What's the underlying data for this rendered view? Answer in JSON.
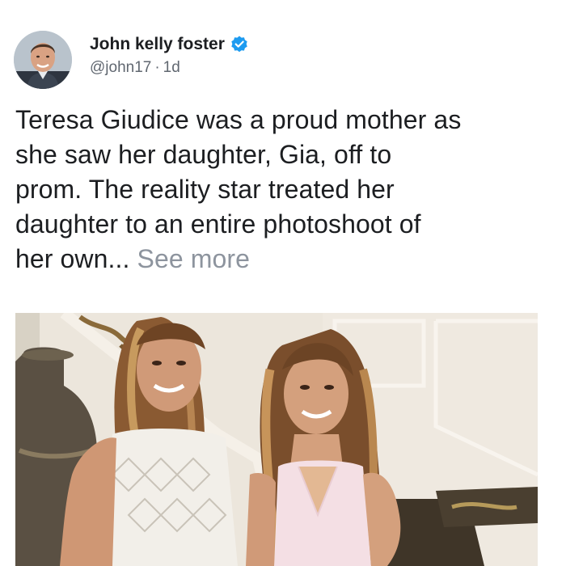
{
  "post": {
    "author": {
      "name": "John kelly foster",
      "handle": "@john17",
      "separator": "·",
      "timestamp": "1d",
      "verified": true,
      "avatar_icon": "profile-photo"
    },
    "text": {
      "lines": [
        "Teresa Giudice was a proud mother as",
        "she saw her daughter, Gia, off to",
        "prom. The reality star treated her",
        "daughter to an entire photoshoot of",
        "her own..."
      ],
      "see_more": "See more"
    },
    "image": {
      "icon": "photo"
    }
  },
  "colors": {
    "verified_blue": "#1d9bf0",
    "see_more_gray": "#8d949e",
    "meta_gray": "#606770"
  }
}
